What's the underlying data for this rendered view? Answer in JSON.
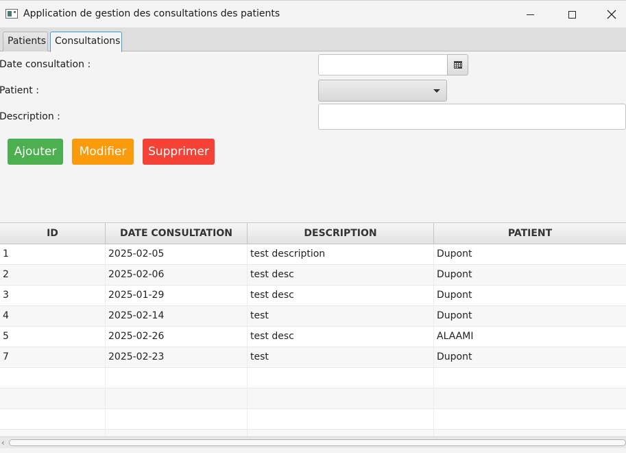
{
  "window": {
    "title": "Application de gestion des consultations des patients"
  },
  "tabs": [
    {
      "label": "Patients",
      "selected": false
    },
    {
      "label": "Consultations",
      "selected": true
    }
  ],
  "form": {
    "date_label": "Date consultation :",
    "date_value": "",
    "patient_label": "Patient :",
    "patient_value": "",
    "description_label": "Description :",
    "description_value": ""
  },
  "buttons": {
    "add": "Ajouter",
    "modify": "Modifier",
    "delete": "Supprimer"
  },
  "colors": {
    "add": "#4caf50",
    "modify": "#fb9a0a",
    "delete": "#f44336",
    "tab_focus": "#3d9bd4"
  },
  "table": {
    "columns": [
      "ID",
      "DATE CONSULTATION",
      "DESCRIPTION",
      "PATIENT"
    ],
    "rows": [
      [
        "1",
        "2025-02-05",
        "test description",
        "Dupont"
      ],
      [
        "2",
        "2025-02-06",
        "test desc",
        "Dupont"
      ],
      [
        "3",
        "2025-01-29",
        "test desc",
        "Dupont"
      ],
      [
        "4",
        "2025-02-14",
        "test",
        "Dupont"
      ],
      [
        "5",
        "2025-02-26",
        "test desc",
        "ALAAMI"
      ],
      [
        "7",
        "2025-02-23",
        "test",
        "Dupont"
      ],
      [
        "",
        "",
        "",
        ""
      ],
      [
        "",
        "",
        "",
        ""
      ],
      [
        "",
        "",
        "",
        ""
      ],
      [
        "",
        "",
        "",
        ""
      ]
    ]
  },
  "icons": {
    "app": "app-window-icon",
    "calendar": "calendar-icon",
    "combo_arrow": "chevron-down-icon",
    "minimize": "minimize-icon",
    "maximize": "maximize-icon",
    "close": "close-icon",
    "scroll_left": "scroll-left-icon"
  }
}
